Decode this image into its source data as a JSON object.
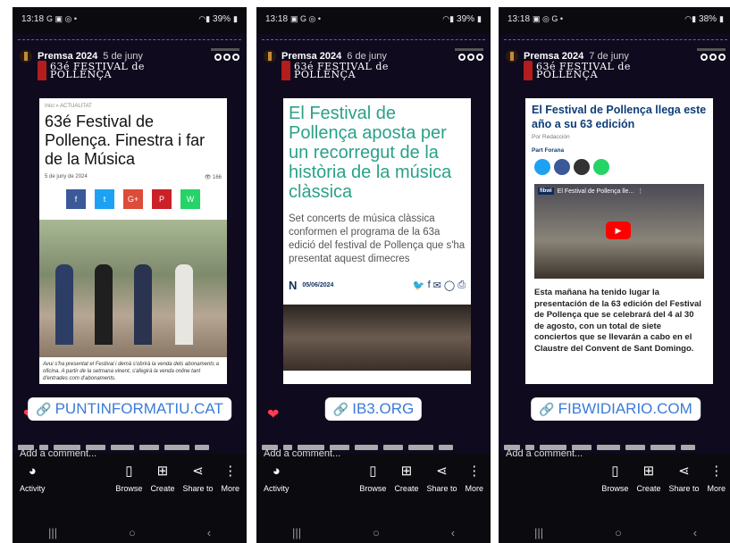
{
  "phones": [
    {
      "status": {
        "time": "13:18",
        "icons": "G ▣ ◎ •",
        "battery": "39%"
      },
      "story": {
        "owner": "Premsa 2024",
        "date": "5 de juny",
        "logo_line1": "63é FESTIVAL de",
        "logo_line2": "POLLENÇA"
      },
      "link": "PUNTINFORMATIU.CAT",
      "card": {
        "crumb": "Inici » ACTUALITAT",
        "title": "63é Festival de Pollença. Finestra i far de la Música",
        "date": "5 de juny de 2024",
        "views": "166",
        "social": [
          "f",
          "t",
          "G+",
          "P",
          "W"
        ],
        "caption": "Avui s'ha presentat el Festival i demà s'obrirà la venda dels abonaments a oficina. A partir de la setmana vinent, s'afegirà la venda online tant d'entrades com d'abonaments."
      }
    },
    {
      "status": {
        "time": "13:18",
        "icons": "▣ G ◎ •",
        "battery": "39%"
      },
      "story": {
        "owner": "Premsa 2024",
        "date": "6 de juny",
        "logo_line1": "63é FESTIVAL de",
        "logo_line2": "POLLENÇA"
      },
      "link": "IB3.ORG",
      "card": {
        "title": "El Festival de Pollença aposta per un recorregut de la història de la música clàssica",
        "lead": "Set concerts de música clàssica conformen el programa de la 63a edició del festival de Pollença que s'ha presentat aquest dimecres",
        "brand": "N",
        "date": "05/06/2024"
      }
    },
    {
      "status": {
        "time": "13:18",
        "icons": "▣ ◎ G •",
        "battery": "38%"
      },
      "story": {
        "owner": "Premsa 2024",
        "date": "7 de juny",
        "logo_line1": "63é FESTIVAL de",
        "logo_line2": "POLLENÇA"
      },
      "link": "FIBWIDIARIO.COM",
      "card": {
        "title": "El Festival de Pollença llega este año a su 63 edición",
        "byline": "Por Redacción",
        "section": "Part Forana",
        "video_brand": "fibwi",
        "video_title": "El Festival de Pollença lle...",
        "body": "Esta mañana ha tenido lugar la presentación de la 63 edición del Festival de Pollença que se celebrará del 4 al 30 de agosto, con un total de siete conciertos que se llevarán a cabo en el Claustre del Convent de Sant Domingo."
      }
    }
  ],
  "common": {
    "add_comment": "Add a comment...",
    "activity": "Activity",
    "browse": "Browse",
    "create": "Create",
    "share": "Share to",
    "more": "More"
  },
  "colors": {
    "story_bg": "#0f0a1e",
    "link_text": "#3b7bd8",
    "heart": "#ff3b50",
    "ib3_title": "#2aa189",
    "fibwi_title": "#0e3d78"
  }
}
